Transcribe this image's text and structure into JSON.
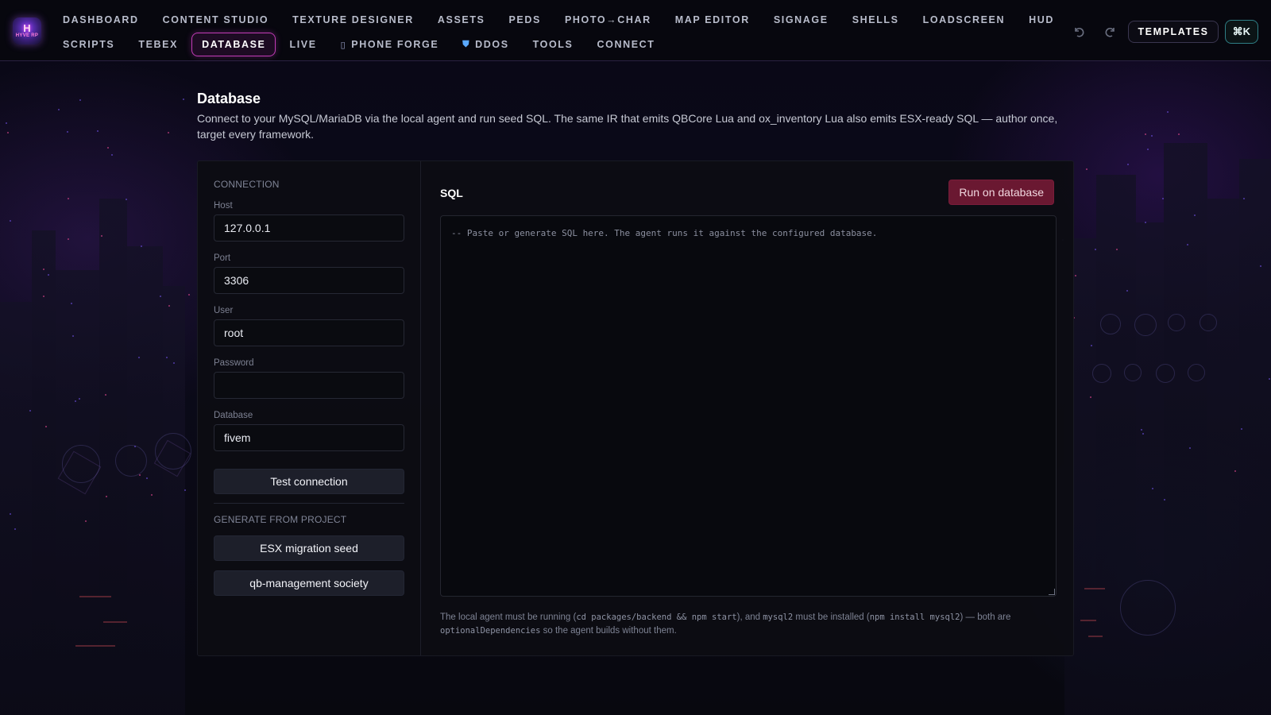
{
  "header": {
    "logo": {
      "mark": "H",
      "sub": "HYVE RP"
    },
    "nav_row1": [
      {
        "label": "DASHBOARD"
      },
      {
        "label": "CONTENT STUDIO"
      },
      {
        "label": "TEXTURE DESIGNER"
      },
      {
        "label": "ASSETS"
      },
      {
        "label": "PEDS"
      },
      {
        "label": "PHOTO→CHAR"
      },
      {
        "label": "MAP EDITOR"
      },
      {
        "label": "SIGNAGE"
      },
      {
        "label": "SHELLS"
      },
      {
        "label": "LOADSCREEN"
      },
      {
        "label": "HUD"
      }
    ],
    "nav_row2": [
      {
        "label": "SCRIPTS"
      },
      {
        "label": "TEBEX"
      },
      {
        "label": "DATABASE",
        "active": true
      },
      {
        "label": "LIVE"
      },
      {
        "label": "PHONE FORGE",
        "icon": "phone-icon",
        "glyph": "▯"
      },
      {
        "label": "DDOS",
        "icon": "shield-icon",
        "glyph": "⛊"
      },
      {
        "label": "TOOLS"
      },
      {
        "label": "CONNECT"
      }
    ],
    "undo_icon": "undo-icon",
    "redo_icon": "redo-icon",
    "templates_label": "TEMPLATES",
    "command_shortcut": "⌘K",
    "accent_color": "#c23bb6"
  },
  "page": {
    "title": "Database",
    "description": "Connect to your MySQL/MariaDB via the local agent and run seed SQL. The same IR that emits QBCore Lua and ox_inventory Lua also emits ESX-ready SQL — author once, target every framework."
  },
  "connection": {
    "section_title": "CONNECTION",
    "host": {
      "label": "Host",
      "value": "127.0.0.1"
    },
    "port": {
      "label": "Port",
      "value": "3306"
    },
    "user": {
      "label": "User",
      "value": "root"
    },
    "password": {
      "label": "Password",
      "value": ""
    },
    "database": {
      "label": "Database",
      "value": "fivem"
    },
    "test_label": "Test connection"
  },
  "generate": {
    "section_title": "GENERATE FROM PROJECT",
    "buttons": [
      {
        "label": "ESX migration seed"
      },
      {
        "label": "qb-management society"
      }
    ]
  },
  "sql": {
    "title": "SQL",
    "run_label": "Run on database",
    "run_color": "#6a1831",
    "placeholder": "-- Paste or generate SQL here. The agent runs it against the configured database.",
    "note": {
      "t1": "The local agent must be running (",
      "c1": "cd packages/backend && npm start",
      "t2": "), and ",
      "c2": "mysql2",
      "t3": " must be installed (",
      "c3": "npm install mysql2",
      "t4": ") — both are ",
      "c4": "optionalDependencies",
      "t5": " so the agent builds without them."
    }
  }
}
